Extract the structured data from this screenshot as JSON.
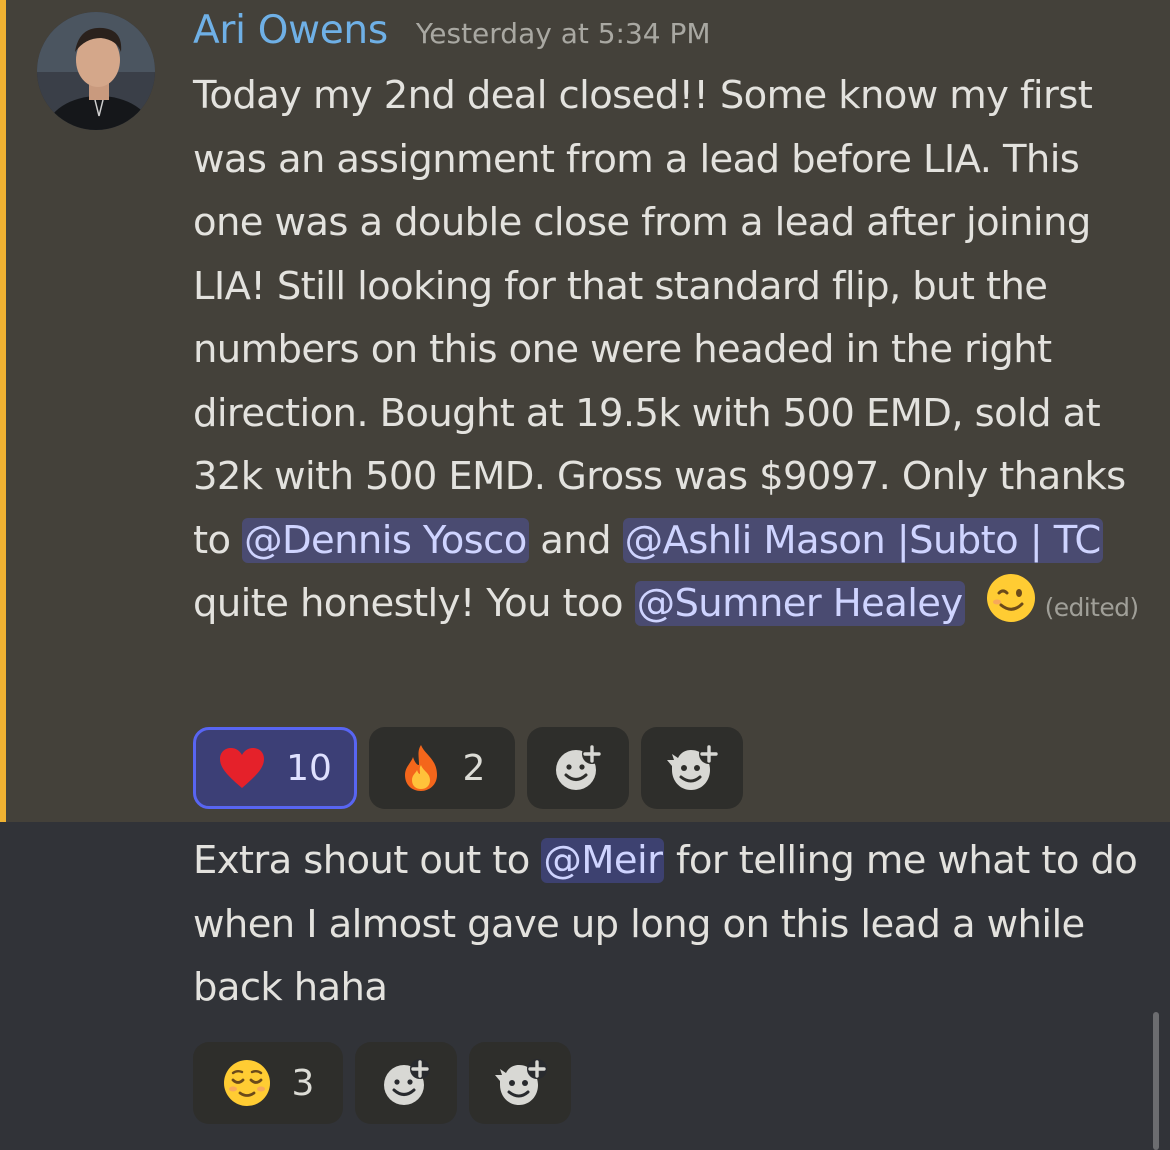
{
  "message1": {
    "author": "Ari Owens",
    "timestamp": "Yesterday at 5:34 PM",
    "text_part1": "Today my 2nd deal closed!! Some know my first was an assignment from a lead before LIA. This one was a double close from a lead after joining LIA! Still looking for that standard flip, but the numbers on this one were headed in the right direction. Bought at 19.5k with 500 EMD, sold at 32k with 500 EMD. Gross was $9097. Only thanks to ",
    "mention1": "@Dennis Yosco",
    "text_part2": " and ",
    "mention2": "@Ashli Mason |Subto | TC",
    "text_part3": " quite honestly! You too ",
    "mention3": "@Sumner Healey",
    "trailing_emoji": "winking-face",
    "edited_label": "(edited)",
    "reactions": [
      {
        "emoji": "red-heart",
        "count": "10",
        "active": true
      },
      {
        "emoji": "fire",
        "count": "2",
        "active": false
      }
    ]
  },
  "message2": {
    "text_part1": "Extra shout out to ",
    "mention1": "@Meir",
    "text_part2": "  for telling me what to do when I almost gave up long on this lead a while back haha",
    "reactions": [
      {
        "emoji": "relieved-face",
        "count": "3",
        "active": false
      }
    ]
  },
  "colors": {
    "highlight_bg": "#44413a",
    "accent_bar": "#f0b232",
    "channel_bg": "#313338",
    "username": "#6fb0e6",
    "mention_bg": "#4c4f8a",
    "active_reaction_border": "#5865f2"
  },
  "icons": {
    "add_reaction": "add-reaction-icon",
    "add_super_reaction": "add-super-reaction-icon"
  }
}
